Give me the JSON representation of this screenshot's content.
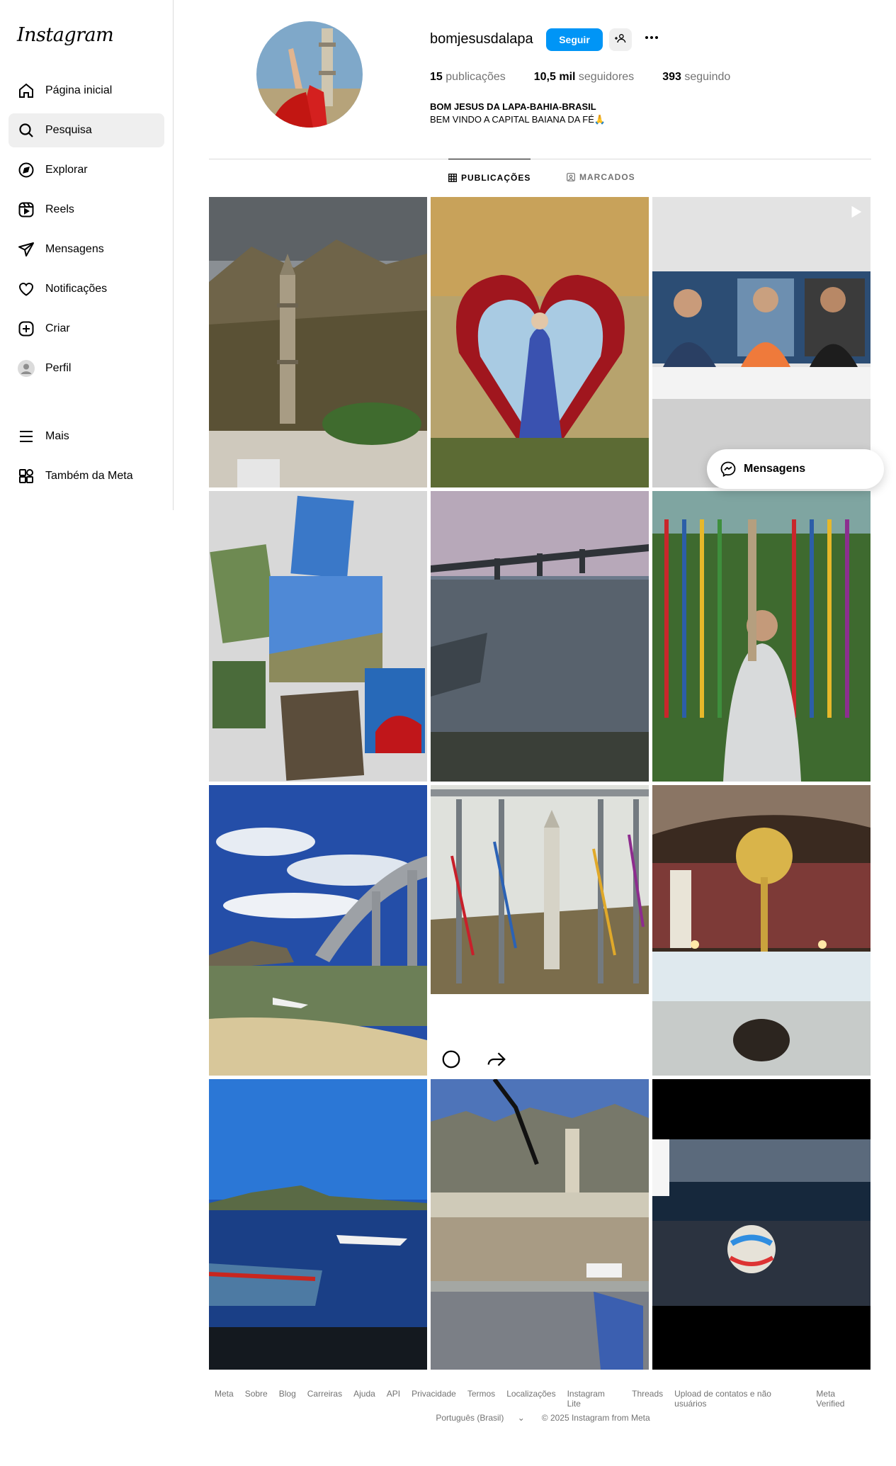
{
  "app": {
    "logo": "Instagram"
  },
  "sidebar": {
    "items": [
      {
        "label": "Página inicial",
        "icon": "home-icon"
      },
      {
        "label": "Pesquisa",
        "icon": "search-icon",
        "active": true
      },
      {
        "label": "Explorar",
        "icon": "compass-icon"
      },
      {
        "label": "Reels",
        "icon": "reels-icon"
      },
      {
        "label": "Mensagens",
        "icon": "send-icon"
      },
      {
        "label": "Notificações",
        "icon": "heart-icon"
      },
      {
        "label": "Criar",
        "icon": "plus-square-icon"
      },
      {
        "label": "Perfil",
        "icon": "profile-avatar-icon"
      }
    ],
    "bottom_items": [
      {
        "label": "Mais",
        "icon": "menu-icon"
      },
      {
        "label": "Também da Meta",
        "icon": "meta-apps-icon"
      }
    ]
  },
  "profile": {
    "username": "bomjesusdalapa",
    "follow_label": "Seguir",
    "stats": {
      "posts_count": "15",
      "posts_label": "publicações",
      "followers_count": "10,5 mil",
      "followers_label": "seguidores",
      "following_count": "393",
      "following_label": "seguindo"
    },
    "bio": {
      "name": "BOM JESUS DA LAPA-BAHIA-BRASIL",
      "line": "BEM VINDO A CAPITAL BAIANA DA FÉ🙏"
    }
  },
  "tabs": [
    {
      "label": "PUBLICAÇÕES",
      "active": true
    },
    {
      "label": "MARCADOS",
      "active": false
    }
  ],
  "messages_pill": {
    "label": "Mensagens"
  },
  "footer": {
    "links": [
      "Meta",
      "Sobre",
      "Blog",
      "Carreiras",
      "Ajuda",
      "API",
      "Privacidade",
      "Termos",
      "Localizações",
      "Instagram Lite",
      "Threads",
      "Upload de contatos e não usuários",
      "Meta Verified"
    ],
    "language": "Português (Brasil)",
    "copyright": "© 2025 Instagram from Meta"
  },
  "colors": {
    "accent": "#0095f6",
    "text": "#262626",
    "muted": "#737373",
    "border": "#dbdbdb"
  }
}
